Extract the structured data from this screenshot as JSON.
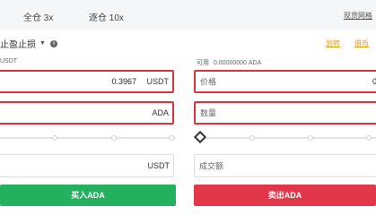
{
  "tabs": {
    "cross": "全仓 3x",
    "isolated": "逐仓 10x"
  },
  "help_link": "现货网格",
  "order_type": "止盈止损",
  "right_links": [
    "划转",
    "借币"
  ],
  "buy": {
    "available": "USDT",
    "price": {
      "value": "0.3967",
      "unit": "USDT"
    },
    "amount": {
      "unit": "ADA"
    },
    "total": {
      "unit": "USDT"
    },
    "button": "买入ADA"
  },
  "sell": {
    "available_label": "可用",
    "available_value": "0.00000000 ADA",
    "price_placeholder": "价格",
    "price_edge": "0",
    "amount_placeholder": "数量",
    "total_placeholder": "成交额",
    "button": "卖出ADA"
  },
  "colors": {
    "buy": "#23b15f",
    "sell": "#e2364b",
    "highlight": "#d9363e",
    "link": "#d4a017"
  },
  "icons": [
    "info-icon",
    "chevron-down-icon"
  ]
}
